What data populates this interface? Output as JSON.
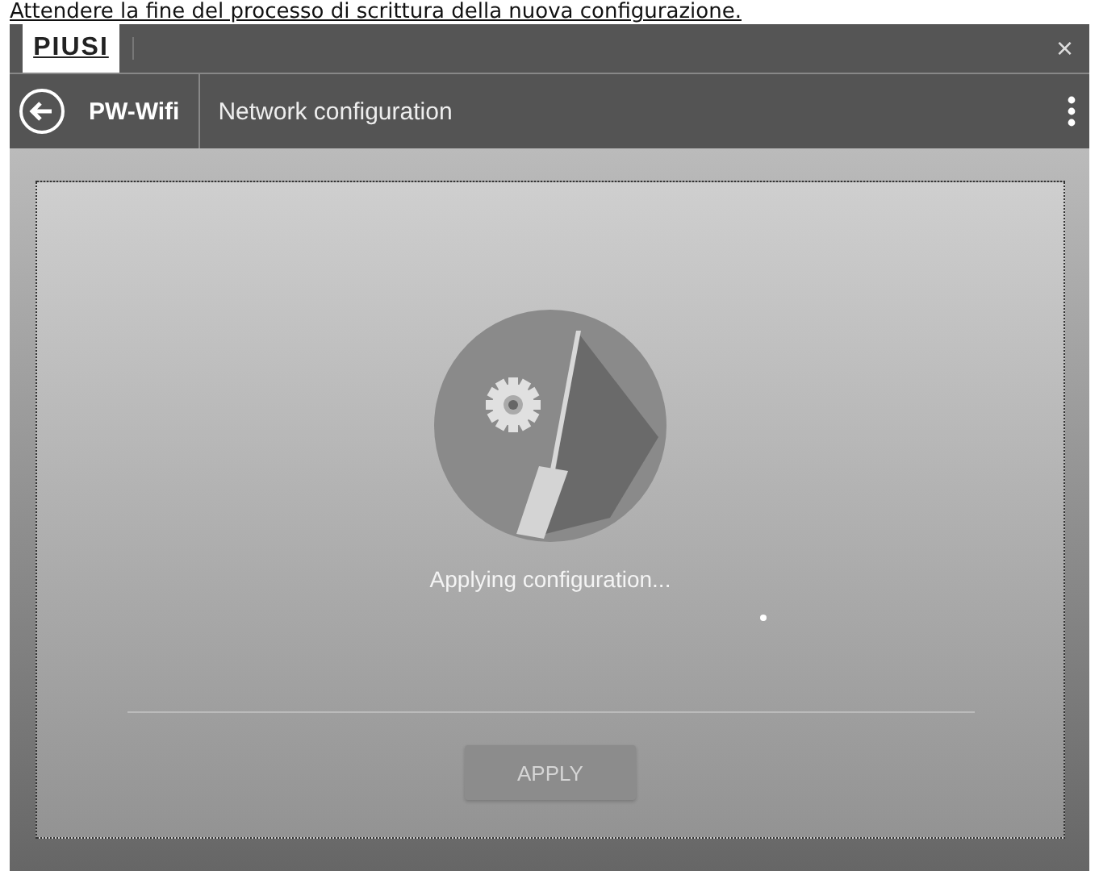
{
  "caption": "Attendere la fine del processo di scrittura della nuova configurazione.",
  "window": {
    "logo": "PIUSI",
    "close": "×"
  },
  "app_bar": {
    "title": "PW-Wifi",
    "subtitle": "Network configuration"
  },
  "status": {
    "message": "Applying configuration..."
  },
  "apply_button": {
    "label": "APPLY",
    "disabled": true
  }
}
